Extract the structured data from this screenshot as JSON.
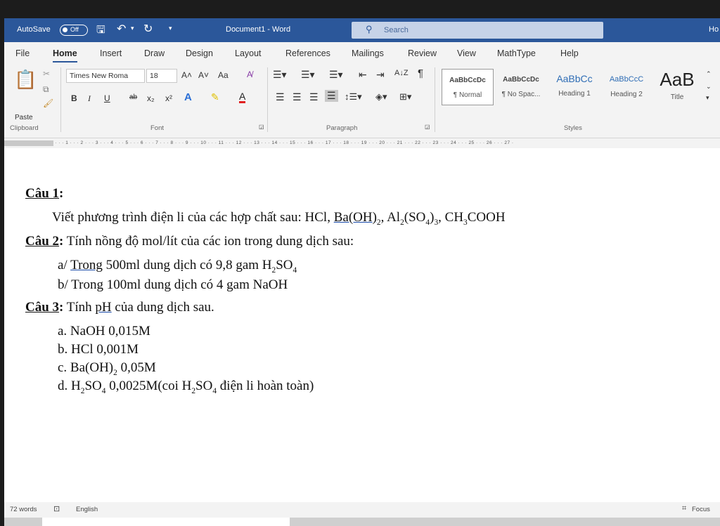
{
  "titlebar": {
    "autosave_label": "AutoSave",
    "autosave_state": "Off",
    "doc_title": "Document1 - Word",
    "search_placeholder": "Search",
    "right_text": "Ho",
    "qat_dropdown": "▾",
    "colors": {
      "bar": "#2b579a",
      "search": "#c6d3e8"
    }
  },
  "menu": {
    "tabs": [
      "File",
      "Home",
      "Insert",
      "Draw",
      "Design",
      "Layout",
      "References",
      "Mailings",
      "Review",
      "View",
      "MathType",
      "Help"
    ],
    "active": "Home"
  },
  "ribbon": {
    "clipboard": {
      "paste_label": "Paste",
      "group_label": "Clipboard"
    },
    "font": {
      "font_name": "Times New Roma",
      "font_size": "18",
      "grow": "A˄",
      "shrink": "A˅",
      "change_case": "Aa",
      "bold": "B",
      "italic": "I",
      "underline": "U",
      "strike": "ab",
      "subscript": "x₂",
      "superscript": "x²",
      "text_effects": "A",
      "font_color": "A",
      "group_label": "Font"
    },
    "paragraph": {
      "group_label": "Paragraph",
      "pilcrow": "¶",
      "sort": "A↓Z"
    },
    "styles": {
      "items": [
        {
          "sample": "AaBbCcDc",
          "name": "¶ Normal"
        },
        {
          "sample": "AaBbCcDc",
          "name": "¶ No Spac..."
        },
        {
          "sample": "AaBbCc",
          "name": "Heading 1"
        },
        {
          "sample": "AaBbCcC",
          "name": "Heading 2"
        },
        {
          "sample": "AaB",
          "name": "Title"
        }
      ],
      "group_label": "Styles"
    }
  },
  "ruler": {
    "marks": "· · · 1 · · · 2 · · · 3 · · · 4 · · · 5 · · · 6 · · · 7 · · · 8 · · · 9 · · · 10 · · · 11 · · · 12 · · · 13 · · · 14 · · · 15 · · · 16 · · · 17 · · · 18 · · · 19 · · · 20 · · · 21 · · · 22 · · · 23 · · · 24 · · · 25 · · · 26 · · · 27 ·"
  },
  "document": {
    "q1": {
      "title": "Câu 1",
      "colon": ":"
    },
    "q1_text": {
      "a": "Viết phương trình điện li của các hợp chất sau: HCl, ",
      "ba": "Ba(OH)",
      "ba_sub": "2",
      "b": ", Al",
      "b_sub": "2",
      "c": "(SO",
      "c_sub": "4",
      "d": ")",
      "d_sub": "3",
      "e": ", CH",
      "e_sub": "3",
      "f": "COOH"
    },
    "q2": {
      "title": "Câu 2",
      "colon": ":",
      "text": " Tính nồng độ mol/lít của các ion trong dung dịch sau:"
    },
    "q2_a": {
      "prefix": "a/ ",
      "trong": "Trong",
      "a": " 500ml dung dịch có 9,8 gam H",
      "sub1": "2",
      "b": "SO",
      "sub2": "4"
    },
    "q2_b": {
      "text": "b/ Trong 100ml dung dịch có 4 gam NaOH"
    },
    "q3": {
      "title": "Câu 3",
      "colon": ":",
      "a": " Tính ",
      "ph": "pH",
      "b": "  của dung dịch sau."
    },
    "q3_a": {
      "text": "a. NaOH 0,015M"
    },
    "q3_b": {
      "text": "b. HCl 0,001M"
    },
    "q3_c": {
      "a": "c. Ba(OH)",
      "sub": "2",
      "b": " 0,05M"
    },
    "q3_d": {
      "a": "d. H",
      "sub1": "2",
      "b": "SO",
      "sub2": "4",
      "c": " 0,0025M(coi H",
      "sub3": "2",
      "d": "SO",
      "sub4": "4",
      "e": " điện li hoàn toàn)"
    }
  },
  "statusbar": {
    "words": "72 words",
    "language": "English",
    "focus": "Focus"
  }
}
